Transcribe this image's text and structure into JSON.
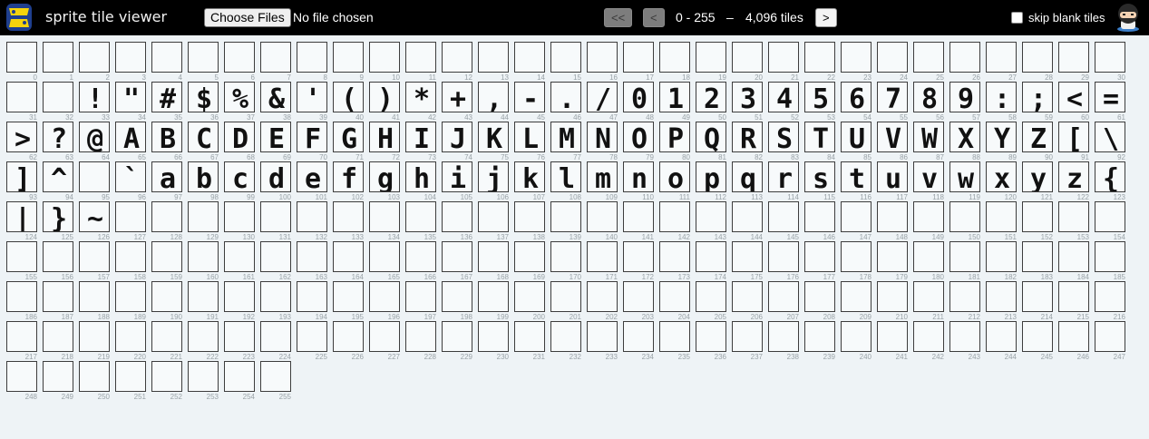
{
  "app": {
    "title": "sprite tile viewer",
    "logo_icon": "neogeo-logo-icon"
  },
  "file": {
    "button_label": "Choose Files",
    "status": "No file chosen"
  },
  "nav": {
    "first_label": "<<",
    "prev_label": "<",
    "next_label": ">",
    "range": "0 - 255",
    "separator": "–",
    "count": "4,096 tiles"
  },
  "options": {
    "skip_blank_label": "skip blank tiles",
    "skip_blank_checked": false
  },
  "user": {
    "avatar_icon": "ninja-avatar-icon"
  },
  "tiles": {
    "first_index": 0,
    "last_index": 255,
    "glyph_text": " !\"#$%&'()*+,-./0123456789:;<=>?@ABCDEFGHIJKLMNOPQRSTUVWXYZ[\\]^_`abcdefghijklmnopqrstuvwxyz{|}~"
  },
  "colors": {
    "topbar": "#000000",
    "background": "#eef3f6",
    "tile_border": "#3d3d3d",
    "glyph": "#111111",
    "index_label": "#9aa3a8"
  }
}
